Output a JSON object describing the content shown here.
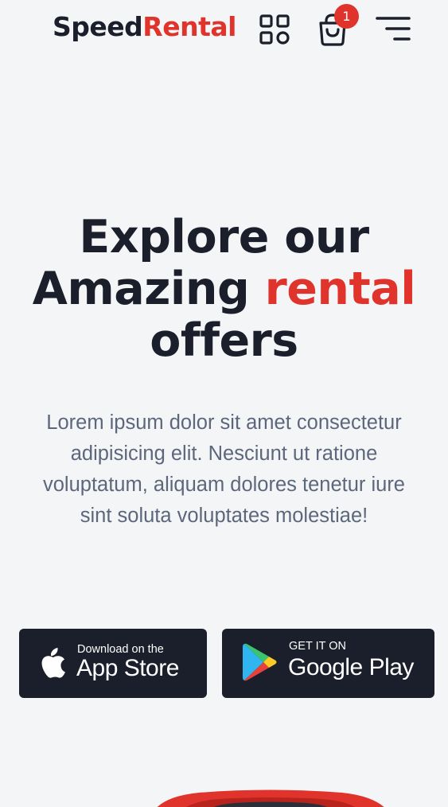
{
  "header": {
    "logo_part1": "Speed",
    "logo_part2": "Rental",
    "cart_count": "1",
    "icons": [
      "grid-icon",
      "shopping-bag-icon",
      "menu-icon"
    ]
  },
  "hero": {
    "title_line1": "Explore our",
    "title_line2_prefix": "Amazing ",
    "title_line2_accent": "rental",
    "title_line3": "offers",
    "description": "Lorem ipsum dolor sit amet consectetur adipisicing elit. Nesciunt ut ratione voluptatum, aliquam dolores tenetur iure sint soluta voluptates molestiae!"
  },
  "stores": {
    "app_store": {
      "small": "Download on the",
      "big": "App Store",
      "icon": "apple-icon"
    },
    "google_play": {
      "small": "GET IT ON",
      "big": "Google Play",
      "icon": "google-play-icon"
    }
  },
  "colors": {
    "accent": "#e0332b",
    "dark": "#1b1f2b",
    "text_muted": "#5d677c",
    "background": "#f4f5f7"
  }
}
